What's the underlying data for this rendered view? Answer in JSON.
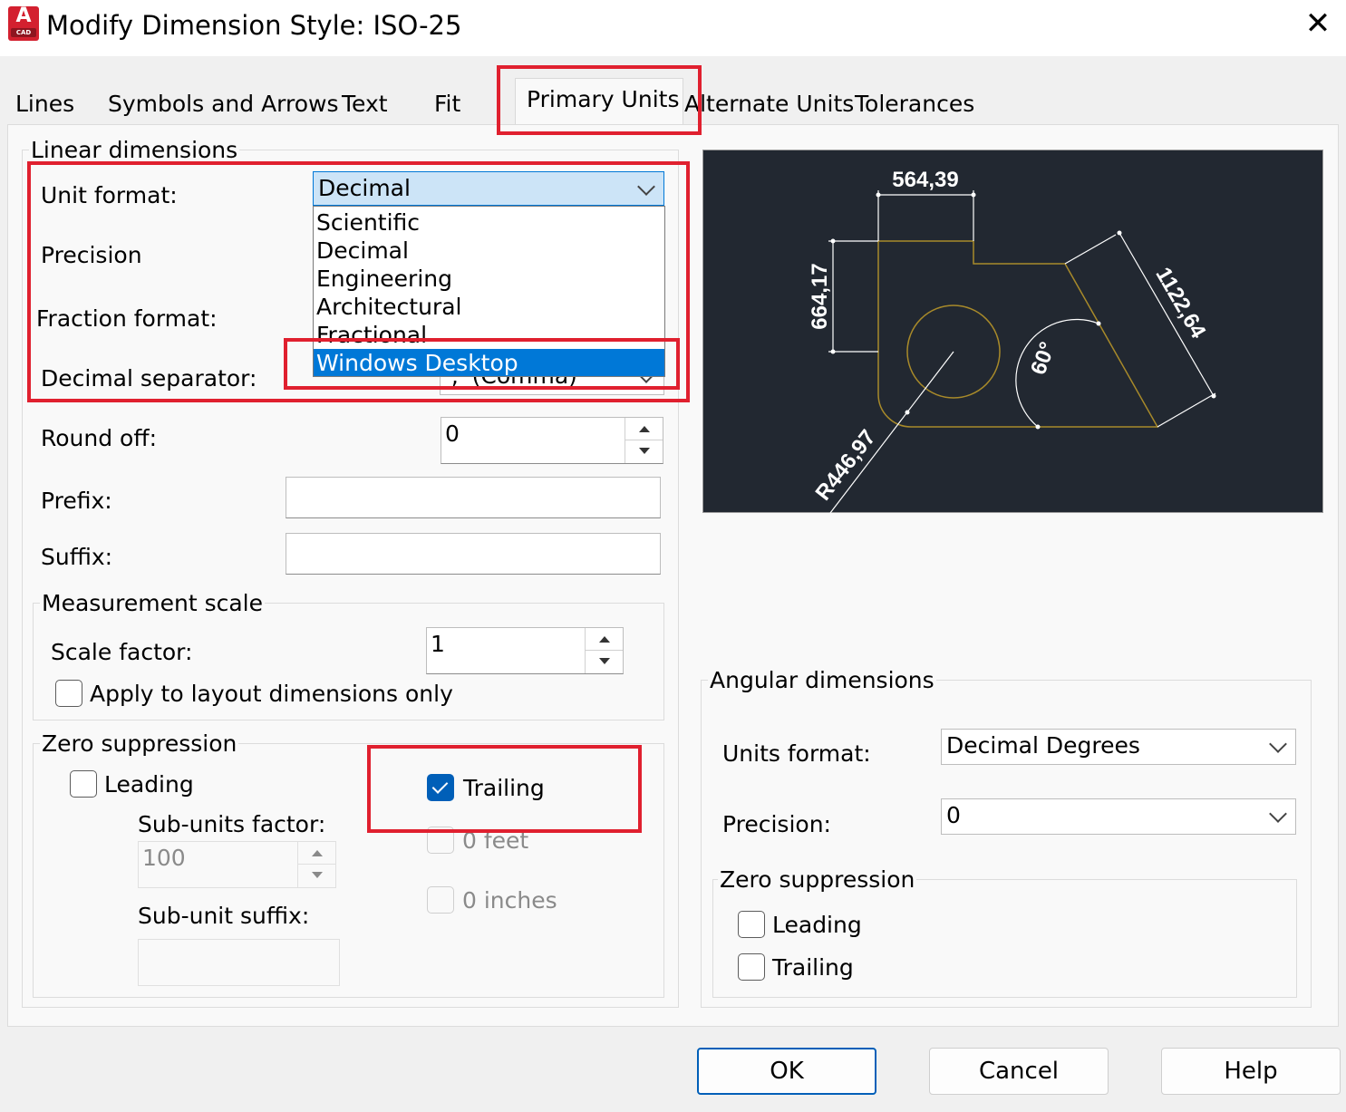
{
  "window": {
    "title": "Modify Dimension Style: ISO-25",
    "icon_letter": "A",
    "icon_sublabel": "CAD",
    "close_glyph": "✕"
  },
  "tabs": [
    {
      "label": "Lines"
    },
    {
      "label": "Symbols and Arrows"
    },
    {
      "label": "Text"
    },
    {
      "label": "Fit"
    },
    {
      "label": "Primary Units",
      "active": true
    },
    {
      "label": "Alternate Units"
    },
    {
      "label": "Tolerances"
    }
  ],
  "linear": {
    "legend": "Linear dimensions",
    "unit_format_label": "Unit format:",
    "unit_format_value": "Decimal",
    "unit_format_options": [
      "Scientific",
      "Decimal",
      "Engineering",
      "Architectural",
      "Fractional",
      "Windows Desktop"
    ],
    "unit_format_highlighted": "Windows Desktop",
    "precision_label": "Precision",
    "fraction_format_label": "Fraction format:",
    "decimal_separator_label": "Decimal separator:",
    "decimal_separator_value": "',' (Comma)",
    "round_off_label": "Round off:",
    "round_off_value": "0",
    "prefix_label": "Prefix:",
    "prefix_value": "",
    "suffix_label": "Suffix:",
    "suffix_value": ""
  },
  "measurement_scale": {
    "legend": "Measurement scale",
    "scale_factor_label": "Scale factor:",
    "scale_factor_value": "1",
    "apply_layout_label": "Apply to layout dimensions only",
    "apply_layout_checked": false
  },
  "zero_suppression_linear": {
    "legend": "Zero suppression",
    "leading_label": "Leading",
    "leading_checked": false,
    "trailing_label": "Trailing",
    "trailing_checked": true,
    "sub_units_factor_label": "Sub-units factor:",
    "sub_units_factor_value": "100",
    "sub_unit_suffix_label": "Sub-unit suffix:",
    "sub_unit_suffix_value": "",
    "zero_feet_label": "0 feet",
    "zero_inches_label": "0 inches"
  },
  "preview": {
    "dim_top": "564,39",
    "dim_left": "664,17",
    "dim_right": "1122,64",
    "dim_angle": "60°",
    "dim_radius": "R446,97"
  },
  "angular": {
    "legend": "Angular dimensions",
    "units_format_label": "Units format:",
    "units_format_value": "Decimal Degrees",
    "precision_label": "Precision:",
    "precision_value": "0",
    "zero_legend": "Zero suppression",
    "leading_label": "Leading",
    "leading_checked": false,
    "trailing_label": "Trailing",
    "trailing_checked": false
  },
  "buttons": {
    "ok": "OK",
    "cancel": "Cancel",
    "help": "Help"
  },
  "colors": {
    "annotation_red": "#e0202f",
    "selection_blue": "#0078d7",
    "preview_bg": "#222831",
    "preview_geometry": "#a88a2a"
  }
}
